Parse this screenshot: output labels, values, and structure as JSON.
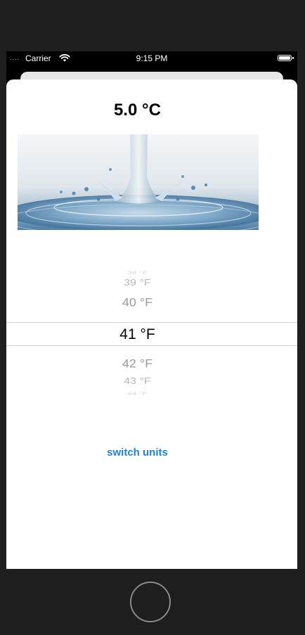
{
  "status_bar": {
    "signal": "....",
    "carrier": "Carrier",
    "time": "9:15 PM"
  },
  "main": {
    "temperature": "5.0 °C",
    "image_icon": "water-splash-image",
    "picker": {
      "items": [
        "38 °F",
        "39 °F",
        "40 °F",
        "41 °F",
        "42 °F",
        "43 °F",
        "44 °F"
      ],
      "selected": "41 °F"
    },
    "switch_units_label": "switch units"
  },
  "icons": {
    "wifi": "wifi-icon",
    "battery": "battery-icon",
    "home": "home-button"
  }
}
